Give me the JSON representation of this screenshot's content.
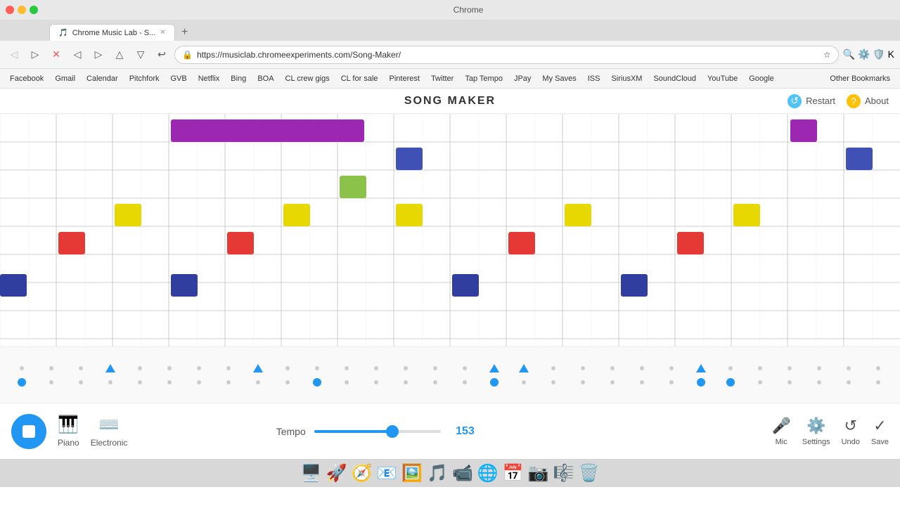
{
  "browser": {
    "title": "Chrome Music Lab - S...",
    "url": "https://musiclab.chromeexperiments.com/Song-Maker/",
    "tabs": [
      {
        "label": "Chrome Music Lab - S...",
        "active": true
      }
    ],
    "bookmarks": [
      "Facebook",
      "Gmail",
      "Calendar",
      "Pitchfork",
      "GVB",
      "Netflix",
      "Bing",
      "BOA",
      "CL crew gigs",
      "CL for sale",
      "Pinterest",
      "Twitter",
      "Tap Tempo",
      "JPay",
      "My Saves",
      "ISS",
      "SiriusXM",
      "SoundCloud",
      "YouTube",
      "Google"
    ],
    "other_bookmarks": "Other Bookmarks"
  },
  "app": {
    "title": "SONG MAKER",
    "restart_label": "Restart",
    "about_label": "About"
  },
  "toolbar": {
    "stop_label": "Stop",
    "piano_label": "Piano",
    "electronic_label": "Electronic",
    "tempo_label": "Tempo",
    "tempo_value": "153",
    "tempo_percent": 62,
    "mic_label": "Mic",
    "settings_label": "Settings",
    "undo_label": "Undo",
    "save_label": "Save"
  },
  "colors": {
    "purple": "#9c27b0",
    "blue": "#3f51b5",
    "green": "#8bc34a",
    "yellow": "#ffeb3b",
    "red": "#e53935",
    "darkblue": "#303f9f",
    "accent": "#2196f3"
  }
}
